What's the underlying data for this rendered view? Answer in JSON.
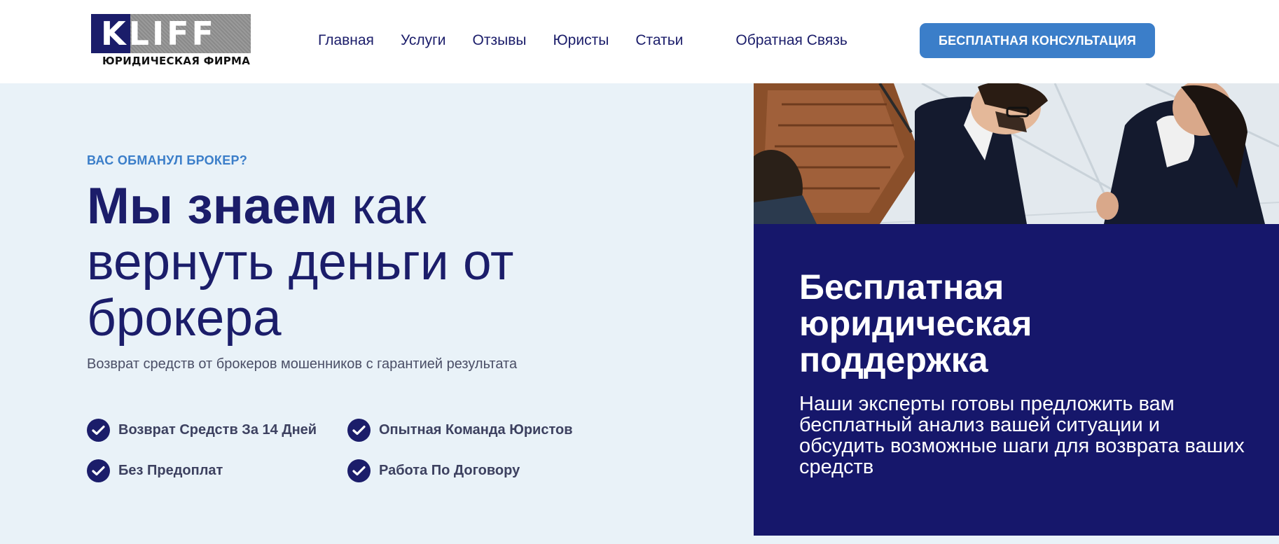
{
  "header": {
    "logo_text": "KLIFF",
    "logo_subtitle": "ЮРИДИЧЕСКАЯ ФИРМА",
    "nav": [
      {
        "label": "Главная"
      },
      {
        "label": "Услуги"
      },
      {
        "label": "Отзывы"
      },
      {
        "label": "Юристы"
      },
      {
        "label": "Статьи"
      },
      {
        "label": "Обратная Связь"
      }
    ],
    "cta_label": "БЕСПЛАТНАЯ КОНСУЛЬТАЦИЯ"
  },
  "hero": {
    "eyebrow": "ВАС ОБМАНУЛ БРОКЕР?",
    "headline_bold": "Мы знаем",
    "headline_rest": " как вернуть деньги от брокера",
    "subline": "Возврат средств от брокеров мошенников с гарантией результата",
    "features": [
      {
        "label": "Возврат Средств За 14 Дней"
      },
      {
        "label": "Опытная Команда Юристов"
      },
      {
        "label": "Без Предоплат"
      },
      {
        "label": "Работа По Договору"
      }
    ]
  },
  "panel": {
    "title": "Бесплатная юридическая поддержка",
    "text": "Наши эксперты готовы предложить вам бесплатный анализ вашей ситуации и обсудить возможные шаги для возврата ваших средств"
  },
  "colors": {
    "navy": "#1b1d6a",
    "panel_navy": "#16176b",
    "accent_blue": "#3b7ec9",
    "hero_bg": "#e9f2f8"
  },
  "icons": {
    "check": "check-circle-icon"
  }
}
